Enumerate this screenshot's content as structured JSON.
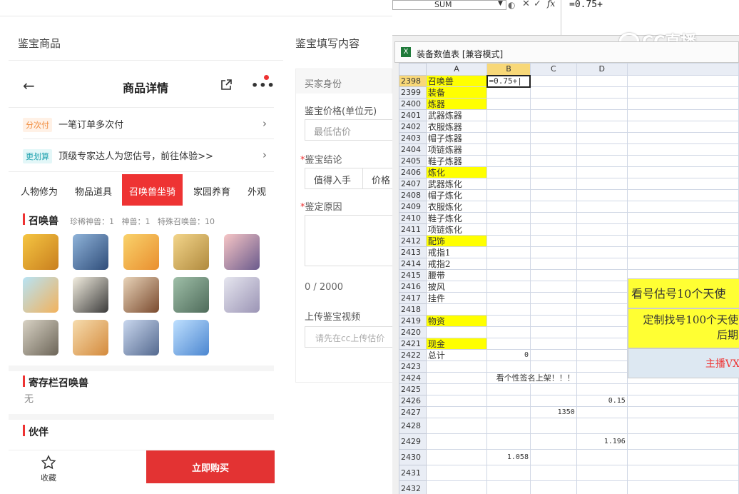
{
  "left": {
    "section_goods": "鉴宝商品",
    "section_form": "鉴宝填写内容",
    "nav_title": "商品详情",
    "installment_tag": "分次付",
    "installment_text": "一笔订单多次付",
    "estimate_tag": "更划算",
    "estimate_text": "顶级专家达人为您估号，前往体验>>",
    "tabs": [
      "人物修为",
      "物品道具",
      "召唤兽坐骑",
      "家园养育",
      "外观"
    ],
    "pet_section": "召唤兽",
    "pet_stats": "珍稀神兽：1   神兽：1   特殊召唤兽：10",
    "storage_section": "寄存栏召唤兽",
    "storage_value": "无",
    "partner_section": "伙伴",
    "favorite_label": "收藏",
    "buy_label": "立即购买",
    "form": {
      "buyer_identity": "买家身份",
      "price_label": "鉴宝价格(单位元)",
      "price_placeholder": "最低估价",
      "conclusion_label": "鉴宝结论",
      "conclusion_option1": "值得入手",
      "conclusion_option2": "价格",
      "reason_label": "鉴定原因",
      "char_count": "0 / 2000",
      "video_label": "上传鉴宝视频",
      "video_placeholder": "请先在cc上传估价"
    }
  },
  "excel": {
    "name_box": "SUM",
    "formula": "=0.75+",
    "window_title": "装备数值表  [兼容模式]",
    "columns": [
      "A",
      "B",
      "C",
      "D"
    ],
    "cell_b2398": "=0.75+|",
    "rows": [
      {
        "n": "2398",
        "a": "召唤兽",
        "yel": true
      },
      {
        "n": "2399",
        "a": "装备",
        "yel": true
      },
      {
        "n": "2400",
        "a": "炼器",
        "yel": true
      },
      {
        "n": "2401",
        "a": "武器炼器"
      },
      {
        "n": "2402",
        "a": "衣服炼器"
      },
      {
        "n": "2403",
        "a": "帽子炼器"
      },
      {
        "n": "2404",
        "a": "项链炼器"
      },
      {
        "n": "2405",
        "a": "鞋子炼器"
      },
      {
        "n": "2406",
        "a": "炼化",
        "yel": true
      },
      {
        "n": "2407",
        "a": "武器炼化"
      },
      {
        "n": "2408",
        "a": "帽子炼化"
      },
      {
        "n": "2409",
        "a": "衣服炼化"
      },
      {
        "n": "2410",
        "a": "鞋子炼化"
      },
      {
        "n": "2411",
        "a": "项链炼化"
      },
      {
        "n": "2412",
        "a": "配饰",
        "yel": true
      },
      {
        "n": "2413",
        "a": "戒指1"
      },
      {
        "n": "2414",
        "a": "戒指2"
      },
      {
        "n": "2415",
        "a": "腰带"
      },
      {
        "n": "2416",
        "a": "披风"
      },
      {
        "n": "2417",
        "a": "挂件"
      },
      {
        "n": "2418",
        "a": ""
      },
      {
        "n": "2419",
        "a": "物资",
        "yel": true
      },
      {
        "n": "2420",
        "a": ""
      },
      {
        "n": "2421",
        "a": "现金",
        "yel": true
      },
      {
        "n": "2422",
        "a": "总计",
        "b": "0"
      },
      {
        "n": "2423",
        "a": ""
      },
      {
        "n": "2424",
        "a": "",
        "b": "看个性签名上架！！！"
      },
      {
        "n": "2425",
        "a": ""
      },
      {
        "n": "2426",
        "a": "",
        "d": "0.15"
      },
      {
        "n": "2427",
        "a": "",
        "c": "1350"
      },
      {
        "n": "2428",
        "a": ""
      },
      {
        "n": "2429",
        "a": "",
        "d": "1.196"
      },
      {
        "n": "2430",
        "a": "",
        "b": "1.058"
      },
      {
        "n": "2431",
        "a": ""
      },
      {
        "n": "2432",
        "a": ""
      }
    ],
    "banner1": "看号估号10个天使",
    "banner2": "定制找号100个天使",
    "banner2b": "后期",
    "banner3": "主播VX",
    "watermark": "CC直播"
  },
  "colors": {
    "accent": "#e33333",
    "yellow": "#ffff00"
  }
}
